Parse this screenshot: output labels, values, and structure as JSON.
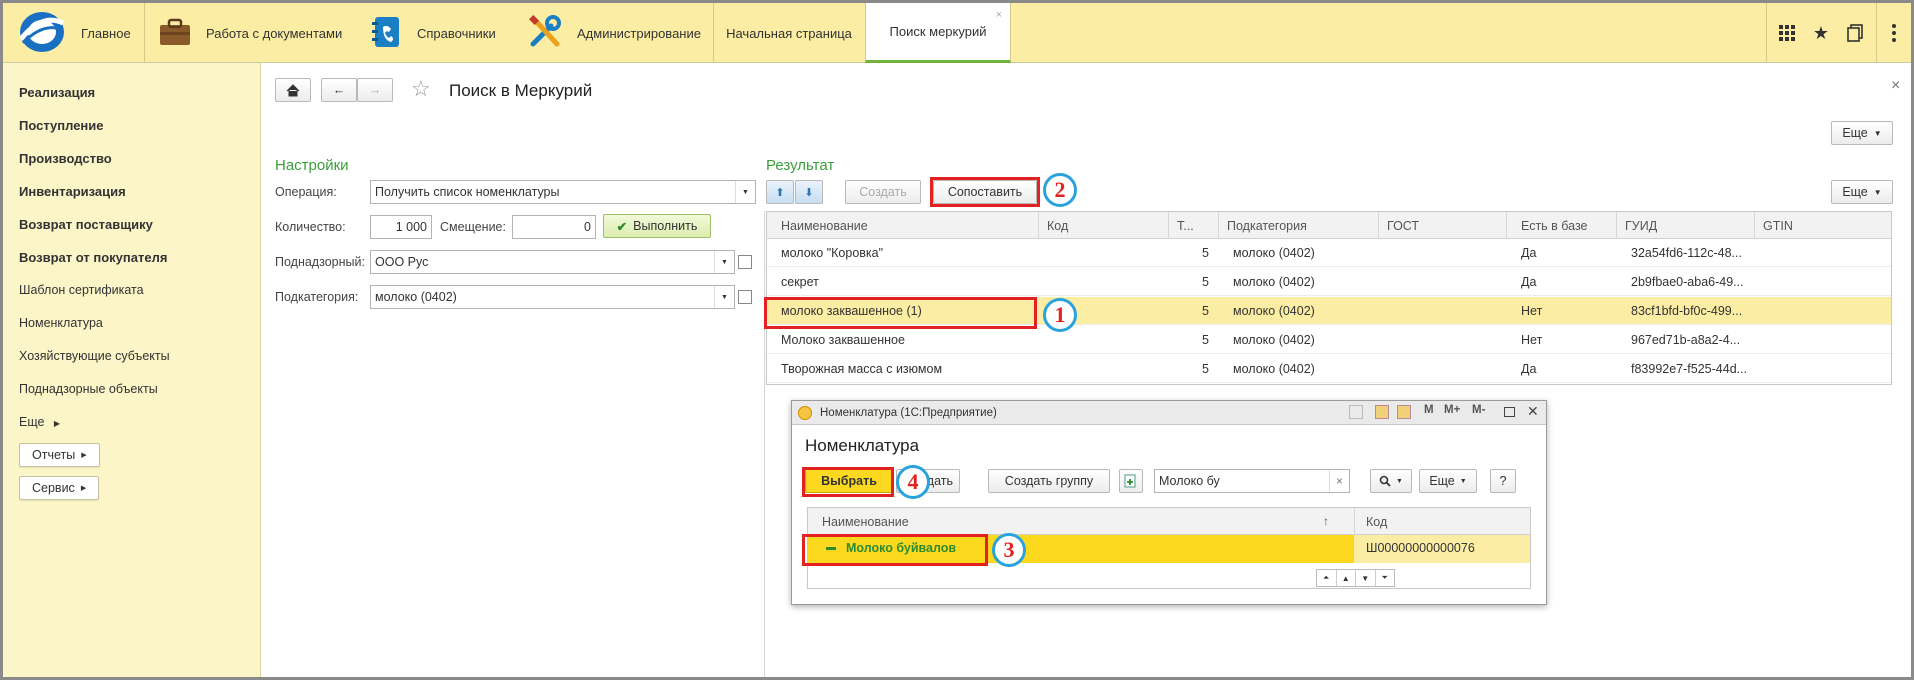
{
  "topbar": {
    "home_label": "Главное",
    "docs_label": "Работа с документами",
    "refs_label": "Справочники",
    "admin_label": "Администрирование",
    "tab_start": "Начальная страница",
    "tab_active": "Поиск меркурий",
    "tab_close": "×"
  },
  "sidebar": {
    "items": [
      {
        "label": "Реализация"
      },
      {
        "label": "Поступление"
      },
      {
        "label": "Производство"
      },
      {
        "label": "Инвентаризация"
      },
      {
        "label": "Возврат поставщику"
      },
      {
        "label": "Возврат от покупателя"
      },
      {
        "label": "Шаблон сертификата"
      },
      {
        "label": "Номенклатура"
      },
      {
        "label": "Хозяйствующие субъекты"
      },
      {
        "label": "Поднадзорные объекты"
      },
      {
        "label": "Еще"
      }
    ],
    "reports_label": "Отчеты",
    "service_label": "Сервис"
  },
  "page": {
    "title": "Поиск в Меркурий",
    "close": "×",
    "more_label": "Еще"
  },
  "settings": {
    "heading": "Настройки",
    "operation_label": "Операция:",
    "operation_value": "Получить список номенклатуры",
    "quantity_label": "Количество:",
    "quantity_value": "1 000",
    "offset_label": "Смещение:",
    "offset_value": "0",
    "execute_label": "Выполнить",
    "supervised_label": "Поднадзорный:",
    "supervised_value": "ООО Рус",
    "subcategory_label": "Подкатегория:",
    "subcategory_value": "молоко (0402)"
  },
  "result": {
    "heading": "Результат",
    "create_label": "Создать",
    "match_label": "Сопоставить",
    "more_label": "Еще",
    "columns": [
      "Наименование",
      "Код",
      "Т...",
      "Подкатегория",
      "ГОСТ",
      "Есть в базе",
      "ГУИД",
      "GTIN"
    ],
    "rows": [
      {
        "name": "молоко \"Коровка\"",
        "code": "",
        "t": "5",
        "sub": "молоко (0402)",
        "gost": "",
        "in_base": "Да",
        "guid": "32a54fd6-112c-48...",
        "gtin": ""
      },
      {
        "name": "секрет",
        "code": "",
        "t": "5",
        "sub": "молоко (0402)",
        "gost": "",
        "in_base": "Да",
        "guid": "2b9fbae0-aba6-49...",
        "gtin": ""
      },
      {
        "name": "молоко заквашенное (1)",
        "code": "",
        "t": "5",
        "sub": "молоко (0402)",
        "gost": "",
        "in_base": "Нет",
        "guid": "83cf1bfd-bf0c-499...",
        "gtin": ""
      },
      {
        "name": "Молоко заквашенное",
        "code": "",
        "t": "5",
        "sub": "молоко (0402)",
        "gost": "",
        "in_base": "Нет",
        "guid": "967ed71b-a8a2-4...",
        "gtin": ""
      },
      {
        "name": "Творожная масса с изюмом",
        "code": "",
        "t": "5",
        "sub": "молоко (0402)",
        "gost": "",
        "in_base": "Да",
        "guid": "f83992e7-f525-44d...",
        "gtin": ""
      }
    ]
  },
  "dialog": {
    "window_title": "Номенклатура (1С:Предприятие)",
    "title": "Номенклатура",
    "select_label": "Выбрать",
    "create_label": "дать",
    "create_group_label": "Создать группу",
    "search_value": "Молоко бу",
    "more_label": "Еще",
    "help_label": "?",
    "tb_m": "M",
    "tb_mplus": "M+",
    "tb_mminus": "M-",
    "col_name": "Наименование",
    "col_code": "Код",
    "sort_mark": "↑",
    "row_name": "Молоко буйвалов",
    "row_code": "Ш00000000000076"
  },
  "annotations": [
    "1",
    "2",
    "3",
    "4"
  ],
  "colors": {
    "topbar_bg": "#fbeda3",
    "sidebar_bg": "#fbf5c8",
    "selection": "#fbeda3",
    "dialog_selection": "#fcd91e",
    "heading_green": "#3b9e3b",
    "annotation_red": "#e32121",
    "annotation_blue": "#2aa3dd"
  }
}
